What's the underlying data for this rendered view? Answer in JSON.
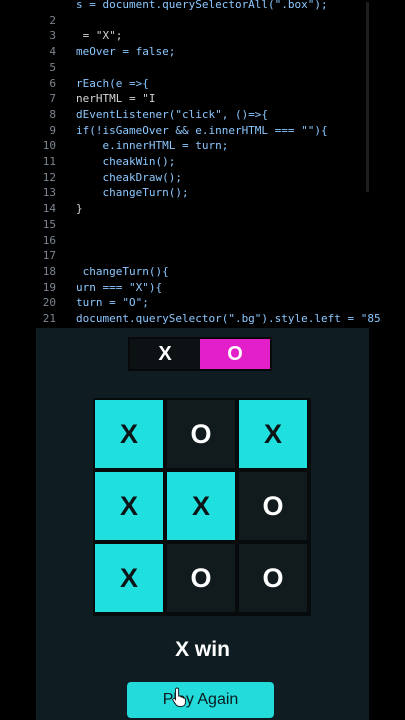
{
  "editor": {
    "lines": [
      {
        "num": "",
        "text": "s = document.querySelectorAll(\".box\");"
      },
      {
        "num": "2",
        "text": ""
      },
      {
        "num": "3",
        "text": " = \"X\";"
      },
      {
        "num": "4",
        "text": "meOver = false;"
      },
      {
        "num": "5",
        "text": ""
      },
      {
        "num": "6",
        "text": "rEach(e =>{"
      },
      {
        "num": "7",
        "text": "nerHTML = \"I"
      },
      {
        "num": "8",
        "text": "dEventListener(\"click\", ()=>{"
      },
      {
        "num": "9",
        "text": "if(!isGameOver && e.innerHTML === \"\"){"
      },
      {
        "num": "10",
        "text": "    e.innerHTML = turn;"
      },
      {
        "num": "11",
        "text": "    cheakWin();"
      },
      {
        "num": "12",
        "text": "    cheakDraw();"
      },
      {
        "num": "13",
        "text": "    changeTurn();"
      },
      {
        "num": "14",
        "text": "}"
      },
      {
        "num": "15",
        "text": ""
      },
      {
        "num": "16",
        "text": ""
      },
      {
        "num": "17",
        "text": ""
      },
      {
        "num": "18",
        "text": " changeTurn(){"
      },
      {
        "num": "19",
        "text": "urn === \"X\"){"
      },
      {
        "num": "20",
        "text": "turn = \"O\";"
      },
      {
        "num": "21",
        "text": "document.querySelector(\".bg\").style.left = \"85"
      }
    ]
  },
  "game": {
    "turn_x": "X",
    "turn_o": "O",
    "active_turn": "O",
    "board": [
      "X",
      "O",
      "X",
      "X",
      "X",
      "O",
      "X",
      "O",
      "O"
    ],
    "winning_cells": [
      0,
      2,
      3,
      4,
      6
    ],
    "result": "X win",
    "play_again_label": "Play Again"
  },
  "colors": {
    "accent_cyan": "#20dfdf",
    "accent_magenta": "#e21fc8",
    "panel_bg": "#0f1d22"
  }
}
